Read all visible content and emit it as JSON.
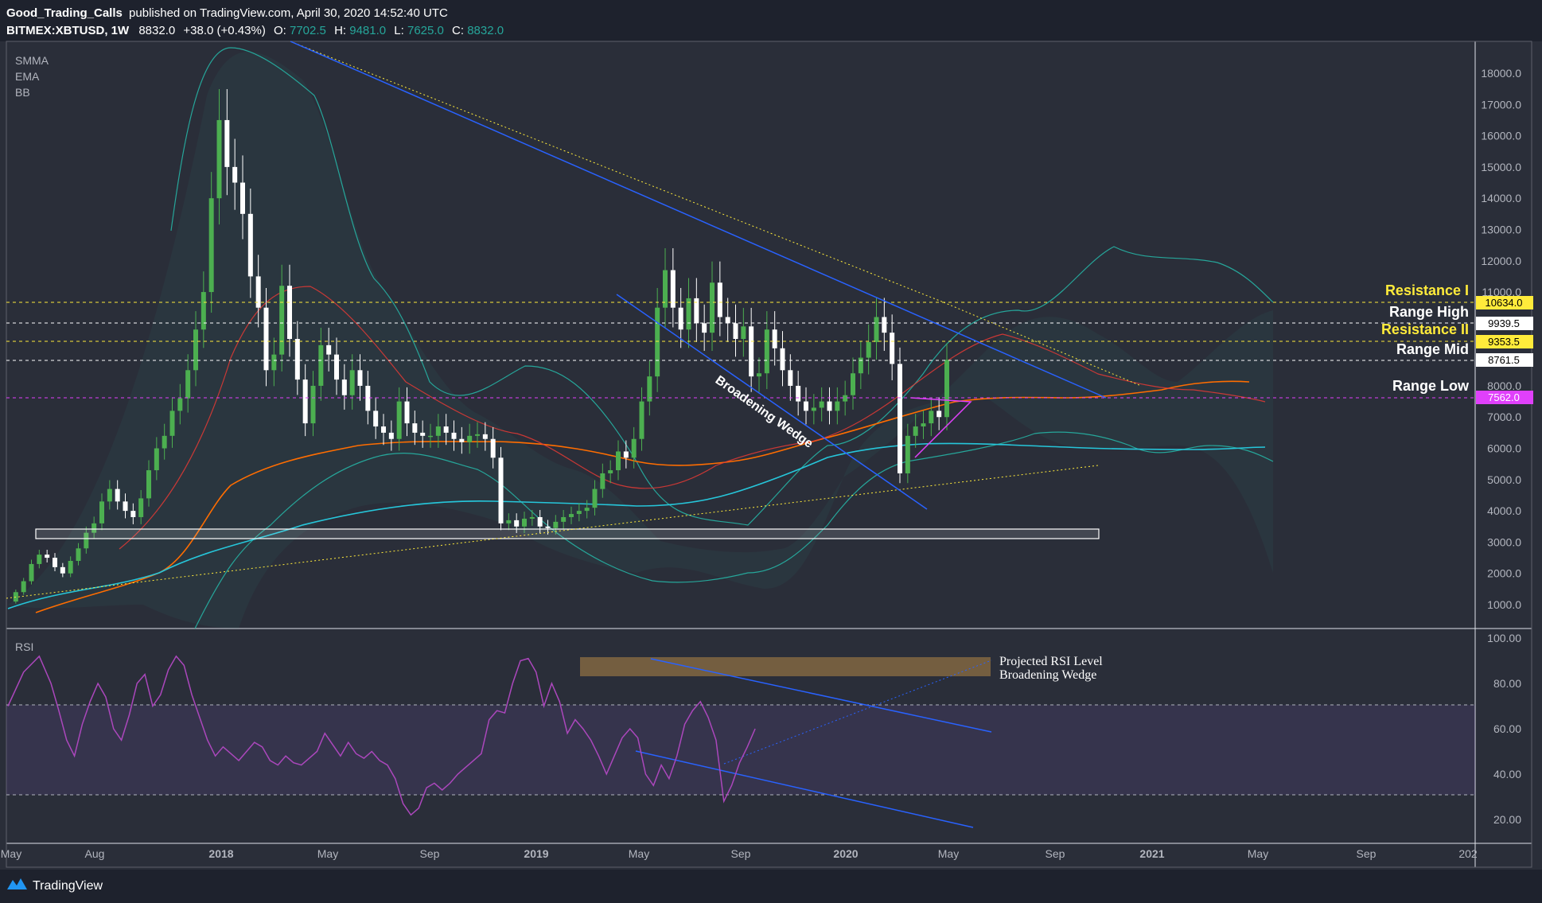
{
  "header": {
    "author": "Good_Trading_Calls",
    "published": "published on TradingView.com, April 30, 2020 14:52:40 UTC",
    "symbol": "BITMEX:XBTUSD, 1W",
    "last": "8832.0",
    "change": "+38.0 (+0.43%)",
    "o_label": "O:",
    "o_value": "7702.5",
    "h_label": "H:",
    "h_value": "9481.0",
    "l_label": "L:",
    "l_value": "7625.0",
    "c_label": "C:",
    "c_value": "8832.0"
  },
  "indicators": [
    "SMMA",
    "EMA",
    "BB"
  ],
  "rsi_label": "RSI",
  "footer": {
    "brand": "TradingView"
  },
  "price_tags": {
    "res1": "10634.0",
    "range_high": "9939.5",
    "res2": "9353.5",
    "range_mid": "8761.5",
    "range_low": "7562.0"
  },
  "labels": {
    "res1": "Resistance I",
    "range_high": "Range High",
    "res2": "Resistance II",
    "range_mid": "Range Mid",
    "range_low": "Range Low",
    "wedge": "Broadening Wedge",
    "rsi_proj_1": "Projected RSI Level",
    "rsi_proj_2": "Broadening Wedge"
  },
  "colors": {
    "background": "#2a2e39",
    "bar": "#1e222d",
    "bull": "#4caf50",
    "bear": "#ffffff",
    "res1": "#ffeb3b",
    "res2": "#ffeb3b",
    "range": "#ffffff",
    "range_low": "#e040fb",
    "smma": "#e53935",
    "ema": "#ff6d00",
    "ma_cyan": "#26c6da",
    "bb": "#26a69a",
    "rsi": "#ab47bc",
    "wedge": "#2962ff"
  },
  "chart_data": [
    {
      "type": "candlestick",
      "symbol": "BITMEX:XBTUSD",
      "timeframe": "1W",
      "x_ticks": [
        "May",
        "Aug",
        "2018",
        "May",
        "Sep",
        "2019",
        "May",
        "Sep",
        "2020",
        "May",
        "Sep",
        "2021",
        "May",
        "Sep",
        "202"
      ],
      "y_ticks": [
        "1000.0",
        "2000.0",
        "3000.0",
        "4000.0",
        "5000.0",
        "6000.0",
        "7000.0",
        "8000.0",
        "11000.0",
        "12000.0",
        "13000.0",
        "14000.0",
        "15000.0",
        "16000.0",
        "17000.0",
        "18000.0"
      ],
      "ylim": [
        0,
        20000
      ],
      "price_path": [
        [
          0,
          1100
        ],
        [
          10,
          1400
        ],
        [
          20,
          1750
        ],
        [
          30,
          2300
        ],
        [
          40,
          2600
        ],
        [
          50,
          2500
        ],
        [
          60,
          2200
        ],
        [
          70,
          2000
        ],
        [
          80,
          2400
        ],
        [
          90,
          2800
        ],
        [
          100,
          3300
        ],
        [
          110,
          3600
        ],
        [
          120,
          4300
        ],
        [
          130,
          4700
        ],
        [
          140,
          4300
        ],
        [
          150,
          4000
        ],
        [
          160,
          3800
        ],
        [
          170,
          4400
        ],
        [
          180,
          5300
        ],
        [
          190,
          6000
        ],
        [
          200,
          6400
        ],
        [
          210,
          7200
        ],
        [
          220,
          7600
        ],
        [
          230,
          8500
        ],
        [
          240,
          9800
        ],
        [
          250,
          11000
        ],
        [
          260,
          14000
        ],
        [
          270,
          16500
        ],
        [
          280,
          15000
        ],
        [
          290,
          14500
        ],
        [
          300,
          13500
        ],
        [
          310,
          11500
        ],
        [
          320,
          10500
        ],
        [
          330,
          8500
        ],
        [
          340,
          9000
        ],
        [
          350,
          11200
        ],
        [
          360,
          9500
        ],
        [
          370,
          8200
        ],
        [
          380,
          6800
        ],
        [
          390,
          8000
        ],
        [
          400,
          9300
        ],
        [
          410,
          9000
        ],
        [
          420,
          8200
        ],
        [
          430,
          7700
        ],
        [
          440,
          8500
        ],
        [
          450,
          8000
        ],
        [
          460,
          7200
        ],
        [
          470,
          6700
        ],
        [
          480,
          6500
        ],
        [
          490,
          6300
        ],
        [
          500,
          7500
        ],
        [
          510,
          6800
        ],
        [
          520,
          6500
        ],
        [
          530,
          6400
        ],
        [
          540,
          6400
        ],
        [
          550,
          6700
        ],
        [
          560,
          6500
        ],
        [
          570,
          6300
        ],
        [
          580,
          6200
        ],
        [
          590,
          6400
        ],
        [
          600,
          6450
        ],
        [
          610,
          6300
        ],
        [
          620,
          5700
        ],
        [
          630,
          3600
        ],
        [
          640,
          3700
        ],
        [
          650,
          3500
        ],
        [
          660,
          3750
        ],
        [
          670,
          3800
        ],
        [
          680,
          3500
        ],
        [
          690,
          3450
        ],
        [
          700,
          3650
        ],
        [
          710,
          3800
        ],
        [
          720,
          3900
        ],
        [
          730,
          4000
        ],
        [
          740,
          4100
        ],
        [
          750,
          4700
        ],
        [
          760,
          5200
        ],
        [
          770,
          5300
        ],
        [
          780,
          5900
        ],
        [
          790,
          5700
        ],
        [
          800,
          6300
        ],
        [
          810,
          7500
        ],
        [
          820,
          8300
        ],
        [
          830,
          10500
        ],
        [
          840,
          11700
        ],
        [
          850,
          10500
        ],
        [
          860,
          9800
        ],
        [
          870,
          10800
        ],
        [
          880,
          10000
        ],
        [
          890,
          9700
        ],
        [
          900,
          11300
        ],
        [
          910,
          10200
        ],
        [
          920,
          10000
        ],
        [
          930,
          9500
        ],
        [
          940,
          9900
        ],
        [
          950,
          8300
        ],
        [
          960,
          8400
        ],
        [
          970,
          9800
        ],
        [
          980,
          9200
        ],
        [
          990,
          8500
        ],
        [
          1000,
          8000
        ],
        [
          1010,
          7500
        ],
        [
          1020,
          7200
        ],
        [
          1030,
          7300
        ],
        [
          1040,
          7500
        ],
        [
          1050,
          7200
        ],
        [
          1060,
          7500
        ],
        [
          1070,
          7700
        ],
        [
          1080,
          8400
        ],
        [
          1090,
          8900
        ],
        [
          1100,
          9400
        ],
        [
          1110,
          10200
        ],
        [
          1120,
          9700
        ],
        [
          1130,
          8700
        ],
        [
          1140,
          5200
        ],
        [
          1150,
          6400
        ],
        [
          1160,
          6700
        ],
        [
          1170,
          6800
        ],
        [
          1180,
          7200
        ],
        [
          1190,
          7000
        ],
        [
          1200,
          8832
        ]
      ],
      "annotations": [
        "Resistance I",
        "Range High",
        "Resistance II",
        "Range Mid",
        "Range Low",
        "Broadening Wedge"
      ]
    },
    {
      "type": "line",
      "name": "RSI",
      "y_ticks": [
        "20.00",
        "40.00",
        "60.00",
        "80.00",
        "100.00"
      ],
      "ylim": [
        10,
        105
      ],
      "rsi_path": [
        [
          0,
          70
        ],
        [
          20,
          85
        ],
        [
          40,
          92
        ],
        [
          55,
          80
        ],
        [
          65,
          68
        ],
        [
          75,
          55
        ],
        [
          85,
          48
        ],
        [
          95,
          62
        ],
        [
          105,
          72
        ],
        [
          115,
          80
        ],
        [
          125,
          74
        ],
        [
          135,
          60
        ],
        [
          145,
          55
        ],
        [
          155,
          66
        ],
        [
          165,
          80
        ],
        [
          175,
          84
        ],
        [
          185,
          70
        ],
        [
          195,
          75
        ],
        [
          205,
          86
        ],
        [
          215,
          92
        ],
        [
          225,
          88
        ],
        [
          235,
          75
        ],
        [
          245,
          65
        ],
        [
          255,
          55
        ],
        [
          265,
          48
        ],
        [
          275,
          52
        ],
        [
          285,
          49
        ],
        [
          295,
          46
        ],
        [
          305,
          50
        ],
        [
          315,
          54
        ],
        [
          325,
          52
        ],
        [
          335,
          46
        ],
        [
          345,
          44
        ],
        [
          355,
          48
        ],
        [
          365,
          45
        ],
        [
          375,
          44
        ],
        [
          385,
          47
        ],
        [
          395,
          50
        ],
        [
          405,
          58
        ],
        [
          415,
          53
        ],
        [
          425,
          48
        ],
        [
          435,
          54
        ],
        [
          445,
          49
        ],
        [
          455,
          47
        ],
        [
          465,
          50
        ],
        [
          475,
          46
        ],
        [
          485,
          44
        ],
        [
          495,
          38
        ],
        [
          505,
          27
        ],
        [
          515,
          22
        ],
        [
          525,
          25
        ],
        [
          535,
          34
        ],
        [
          545,
          36
        ],
        [
          555,
          33
        ],
        [
          565,
          36
        ],
        [
          575,
          40
        ],
        [
          585,
          43
        ],
        [
          595,
          46
        ],
        [
          605,
          49
        ],
        [
          615,
          64
        ],
        [
          625,
          68
        ],
        [
          635,
          67
        ],
        [
          645,
          80
        ],
        [
          655,
          90
        ],
        [
          665,
          91
        ],
        [
          675,
          85
        ],
        [
          685,
          70
        ],
        [
          695,
          80
        ],
        [
          705,
          72
        ],
        [
          715,
          58
        ],
        [
          725,
          64
        ],
        [
          735,
          60
        ],
        [
          745,
          55
        ],
        [
          755,
          48
        ],
        [
          765,
          40
        ],
        [
          775,
          48
        ],
        [
          785,
          56
        ],
        [
          795,
          60
        ],
        [
          805,
          56
        ],
        [
          815,
          40
        ],
        [
          825,
          35
        ],
        [
          835,
          44
        ],
        [
          845,
          38
        ],
        [
          855,
          48
        ],
        [
          865,
          62
        ],
        [
          875,
          68
        ],
        [
          885,
          72
        ],
        [
          895,
          65
        ],
        [
          905,
          55
        ],
        [
          915,
          28
        ],
        [
          925,
          35
        ],
        [
          935,
          45
        ],
        [
          945,
          52
        ],
        [
          955,
          60
        ]
      ]
    }
  ]
}
